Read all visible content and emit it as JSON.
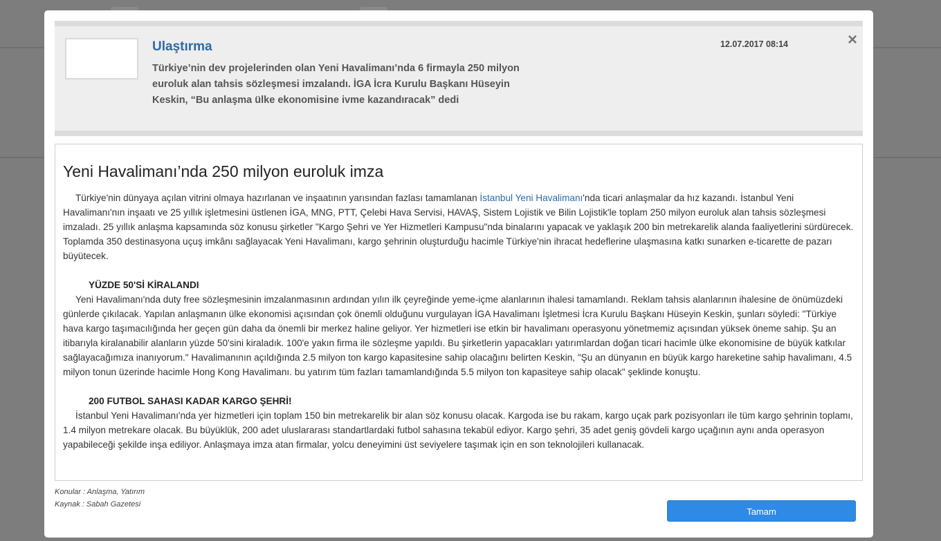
{
  "modal": {
    "header": {
      "category": "Ulaştırma",
      "summary": "Türkiye’nin dev projelerinden olan Yeni Havalimanı’nda 6 firmayla 250 milyon euroluk alan tahsis sözleşmesi imzalandı. İGA İcra Kurulu Başkanı Hüseyin Keskin, “Bu anlaşma ülke ekonomisine ivme kazandıracak” dedi",
      "date": "12.07.2017 08:14",
      "close_label": "×"
    },
    "article": {
      "title": "Yeni Havalimanı’nda 250 milyon euroluk imza",
      "p1_before_link": "Türkiye'nin dünyaya açılan vitrini olmaya hazırlanan ve inşaatının yarısından fazlası tamamlanan ",
      "p1_link": "İstanbul Yeni Havalimanı",
      "p1_after_link": "'nda ticari anlaşmalar da hız kazandı. İstanbul Yeni Havalimanı'nın inşaatı ve 25 yıllık işletmesini üstlenen İGA, MNG, PTT, Çelebi Hava Servisi, HAVAŞ, Sistem Lojistik ve Bilin Lojistik'le toplam 250 milyon euroluk alan tahsis sözleşmesi imzaladı. 25 yıllık anlaşma kapsamında söz konusu şirketler \"Kargo Şehri ve Yer Hizmetleri Kampusu\"nda binalarını yapacak ve yaklaşık 200 bin metrekarelik alanda faaliyetlerini sürdürecek. Toplamda 350 destinasyona uçuş imkânı sağlayacak Yeni Havalimanı, kargo şehrinin oluşturduğu hacimle Türkiye'nin ihracat hedeflerine ulaşmasına katkı sunarken e-ticarette de pazarı büyütecek.",
      "subheading1": "YÜZDE 50'Sİ KİRALANDI",
      "p2": "Yeni Havalimanı'nda duty free sözleşmesinin imzalanmasının ardından yılın ilk çeyreğinde yeme-içme alanlarının ihalesi tamamlandı. Reklam tahsis alanlarının ihalesine de önümüzdeki günlerde çıkılacak. Yapılan anlaşmanın ülke ekonomisi açısından çok önemli olduğunu vurgulayan İGA Havalimanı İşletmesi İcra Kurulu Başkanı Hüseyin Keskin, şunları söyledi: \"Türkiye hava kargo taşımacılığında her geçen gün daha da önemli bir merkez haline geliyor. Yer hizmetleri ise etkin bir havalimanı operasyonu yönetmemiz açısından yüksek öneme sahip. Şu an itibarıyla kiralanabilir alanların yüzde 50'sini kiraladık. 100'e yakın firma ile sözleşme yapıldı. Bu şirketlerin yapacakları yatırımlardan doğan ticari hacimle ülke ekonomisine de büyük katkılar sağlayacağımıza inanıyorum.\" Havalimanının açıldığında 2.5 milyon ton kargo kapasitesine sahip olacağını belirten Keskin, \"Şu an dünyanın en büyük kargo hareketine sahip havalimanı, 4.5 milyon tonun üzerinde hacimle Hong Kong Havalimanı. bu yatırım tüm fazları tamamlandığında 5.5 milyon ton kapasiteye sahip olacak\" şeklinde konuştu.",
      "subheading2": "200 FUTBOL SAHASI KADAR KARGO ŞEHRİ!",
      "p3": "İstanbul Yeni Havalimanı'nda yer hizmetleri için toplam 150 bin metrekarelik bir alan söz konusu olacak. Kargoda ise bu rakam, kargo uçak park pozisyonları ile tüm kargo şehrinin toplamı, 1.4 milyon metrekare olacak. Bu büyüklük, 200 adet uluslararası standartlardaki futbol sahasına tekabül ediyor. Kargo şehri, 35 adet geniş gövdeli kargo uçağının aynı anda operasyon yapabileceği şekilde inşa ediliyor. Anlaşmaya imza atan firmalar, yolcu deneyimini üst seviyelere taşımak için en son teknolojileri kullanacak."
    },
    "footer": {
      "topics": "Konular : Anlaşma, Yatırım",
      "source": "Kaynak : Sabah Gazetesi",
      "ok_label": "Tamam"
    }
  }
}
